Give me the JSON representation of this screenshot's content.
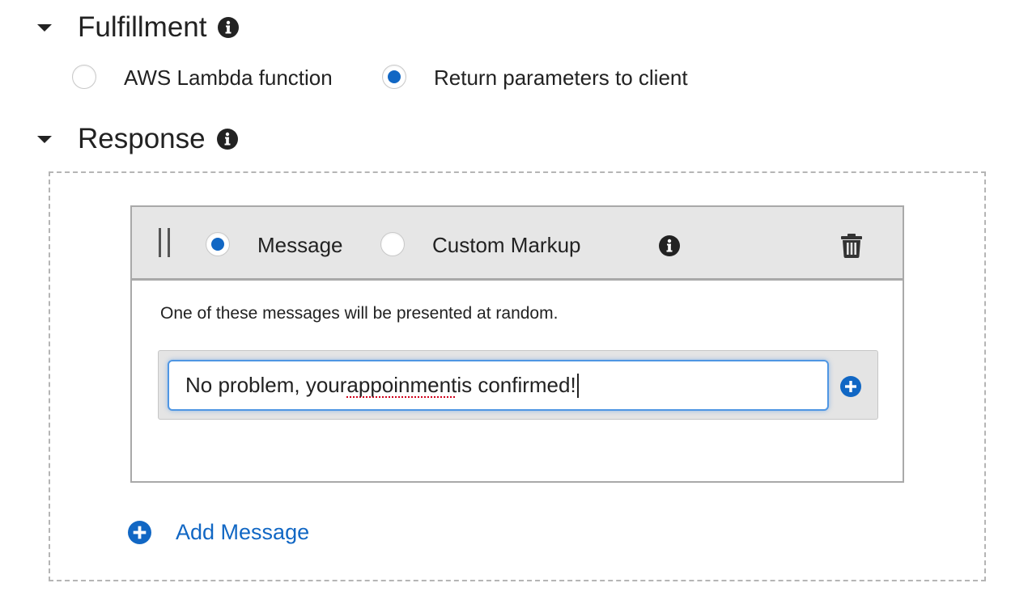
{
  "fulfillment": {
    "title": "Fulfillment",
    "info_icon": "info-circle-icon",
    "options": [
      {
        "label": "AWS Lambda function",
        "selected": false
      },
      {
        "label": "Return parameters to client",
        "selected": true
      }
    ]
  },
  "response": {
    "title": "Response",
    "info_icon": "info-circle-icon",
    "card": {
      "type_options": [
        {
          "label": "Message",
          "selected": true
        },
        {
          "label": "Custom Markup",
          "selected": false
        }
      ],
      "hint": "One of these messages will be presented at random.",
      "message_value_parts": {
        "before": "No problem, your ",
        "misspelled": "appoinment",
        "after": " is confirmed!"
      },
      "icons": {
        "drag": "drag-handle-icon",
        "info": "info-circle-icon",
        "delete": "trash-icon",
        "add_variant": "plus-circle-icon"
      }
    },
    "add_message_label": "Add Message"
  },
  "colors": {
    "accent": "#1167c4",
    "focus_border": "#4f96e3",
    "card_header_bg": "#e6e6e6",
    "dashed_border": "#b5b5b5"
  }
}
